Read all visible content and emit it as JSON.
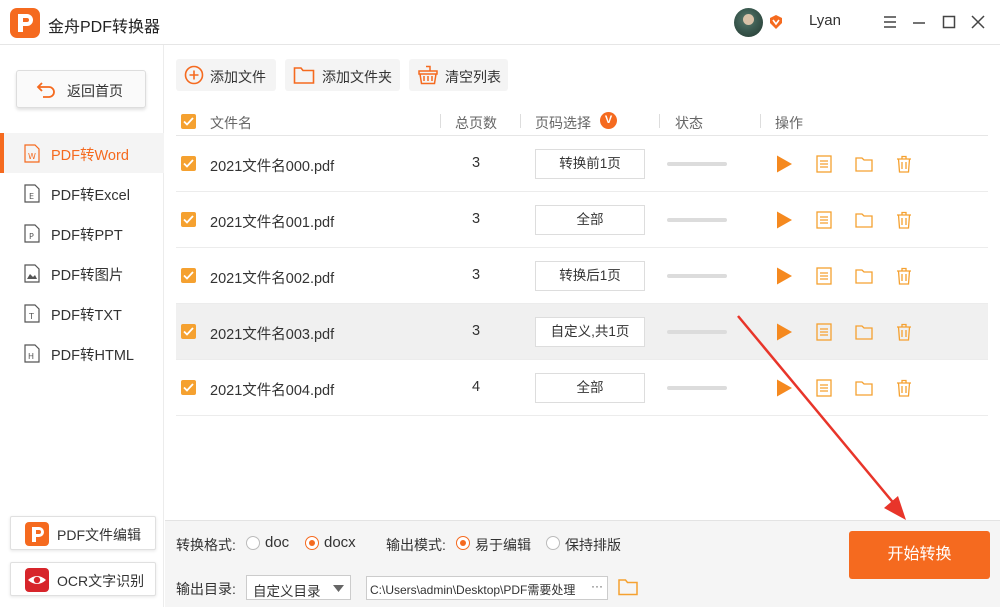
{
  "app": {
    "title": "金舟PDF转换器",
    "username": "Lyan"
  },
  "sidebar": {
    "back_label": "返回首页",
    "items": [
      {
        "label": "PDF转Word",
        "glyph": "W",
        "active": true
      },
      {
        "label": "PDF转Excel",
        "glyph": "E",
        "active": false
      },
      {
        "label": "PDF转PPT",
        "glyph": "P",
        "active": false
      },
      {
        "label": "PDF转图片",
        "glyph": "img",
        "active": false
      },
      {
        "label": "PDF转TXT",
        "glyph": "T",
        "active": false
      },
      {
        "label": "PDF转HTML",
        "glyph": "H",
        "active": false
      }
    ],
    "tools": [
      {
        "label": "PDF文件编辑",
        "icon": "pdf-edit-icon"
      },
      {
        "label": "OCR文字识别",
        "icon": "ocr-eye-icon"
      }
    ]
  },
  "toolbar": {
    "add_file": "添加文件",
    "add_folder": "添加文件夹",
    "clear_list": "清空列表"
  },
  "table": {
    "headers": {
      "filename": "文件名",
      "pages": "总页数",
      "range": "页码选择",
      "range_badge": "V",
      "status": "状态",
      "actions": "操作"
    },
    "rows": [
      {
        "name": "2021文件名000.pdf",
        "pages": "3",
        "range": "转换前1页",
        "progress": 0
      },
      {
        "name": "2021文件名001.pdf",
        "pages": "3",
        "range": "全部",
        "progress": 0
      },
      {
        "name": "2021文件名002.pdf",
        "pages": "3",
        "range": "转换后1页",
        "progress": 0
      },
      {
        "name": "2021文件名003.pdf",
        "pages": "3",
        "range": "自定义,共1页",
        "progress": 0
      },
      {
        "name": "2021文件名004.pdf",
        "pages": "4",
        "range": "全部",
        "progress": 0
      }
    ]
  },
  "bottom": {
    "format_label": "转换格式:",
    "format_options": [
      "doc",
      "docx"
    ],
    "format_selected": "docx",
    "mode_label": "输出模式:",
    "mode_options": [
      "易于编辑",
      "保持排版"
    ],
    "mode_selected": "易于编辑",
    "dir_label": "输出目录:",
    "dir_select": "自定义目录",
    "path": "C:\\Users\\admin\\Desktop\\PDF需要处理",
    "path_more": "···",
    "start_label": "开始转换"
  },
  "colors": {
    "accent": "#f56a1f",
    "checkbox": "#f5a130",
    "arrow": "#e8352a"
  }
}
